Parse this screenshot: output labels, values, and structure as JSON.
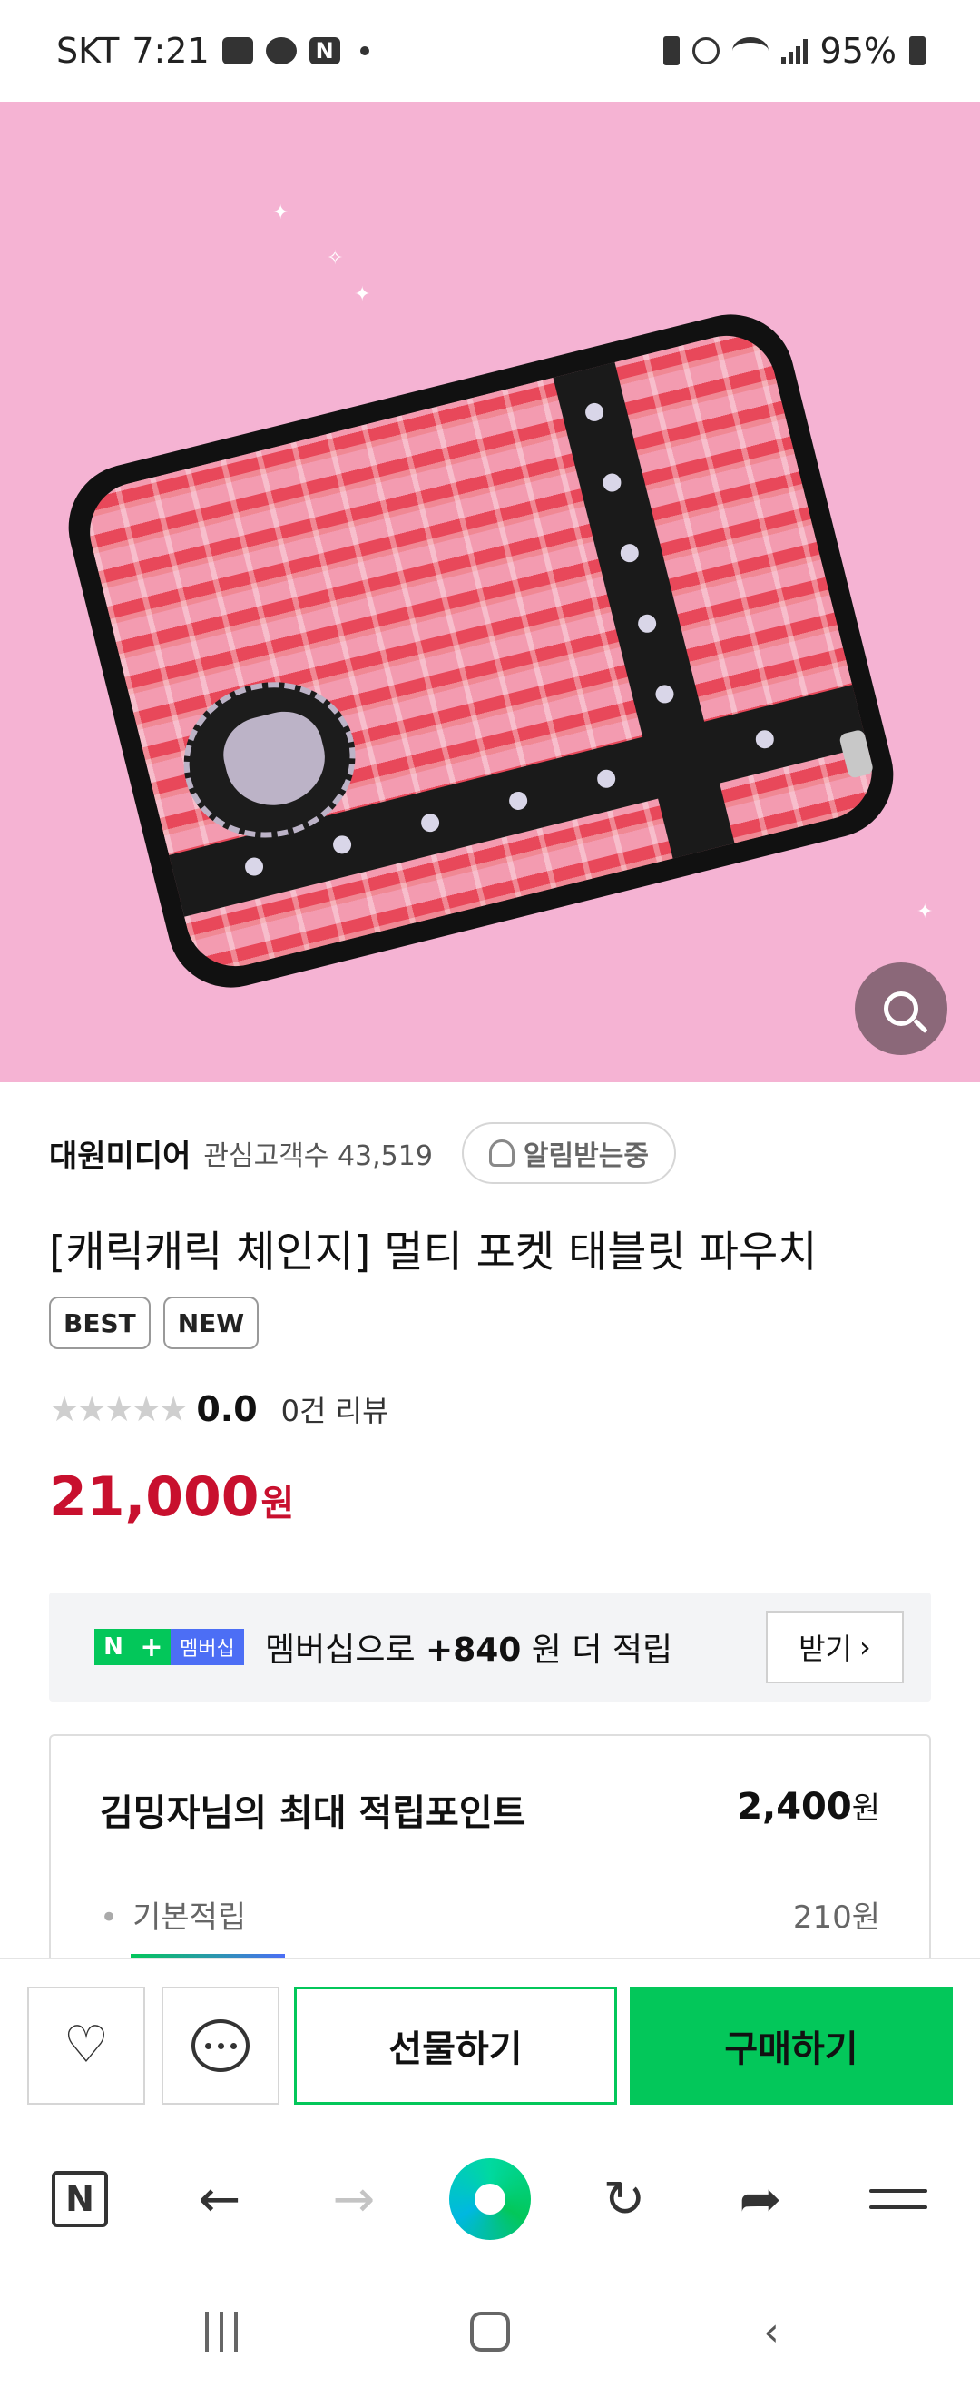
{
  "status_bar": {
    "carrier": "SKT",
    "time": "7:21",
    "battery": "95%"
  },
  "gallery": {
    "page_count": 2,
    "active_index": 0,
    "zoom_icon": "search-icon"
  },
  "seller": {
    "name": "대원미디어",
    "follow_text": "관심고객수 43,519",
    "alarm_label": "알림받는중",
    "alarm_icon": "bell-icon"
  },
  "product": {
    "title": "[캐릭캐릭 체인지] 멀티 포켓 태블릿 파우치",
    "tags": [
      "BEST",
      "NEW"
    ],
    "rating": {
      "stars": "★★★★★",
      "score": "0.0",
      "review_count": "0건 리뷰"
    },
    "price": {
      "value": "21,000",
      "unit": "원"
    }
  },
  "membership": {
    "badge_n": "N",
    "badge_plus": "+",
    "badge_text": "멤버십",
    "text_prefix": "멤버십으로 ",
    "amount": "+840",
    "text_suffix": " 원 더 적립",
    "receive_label": "받기",
    "receive_chevron": "›"
  },
  "points": {
    "title": "김밍자님의 최대 적립포인트",
    "total": "2,400",
    "unit": "원",
    "basic_label": "기본적립",
    "basic_value": "210원"
  },
  "actions": {
    "wishlist_icon": "heart-icon",
    "talk_icon": "chat-icon",
    "gift_label": "선물하기",
    "buy_label": "구매하기"
  },
  "browser": {
    "home_label": "N",
    "back_icon": "←",
    "forward_icon": "→",
    "refresh_icon": "↻",
    "share_icon": "➦"
  },
  "colors": {
    "accent_green": "#03c75a",
    "price_red": "#c8102e",
    "membership_blue": "#4c6ef5",
    "hero_pink": "#f5b3d3"
  }
}
